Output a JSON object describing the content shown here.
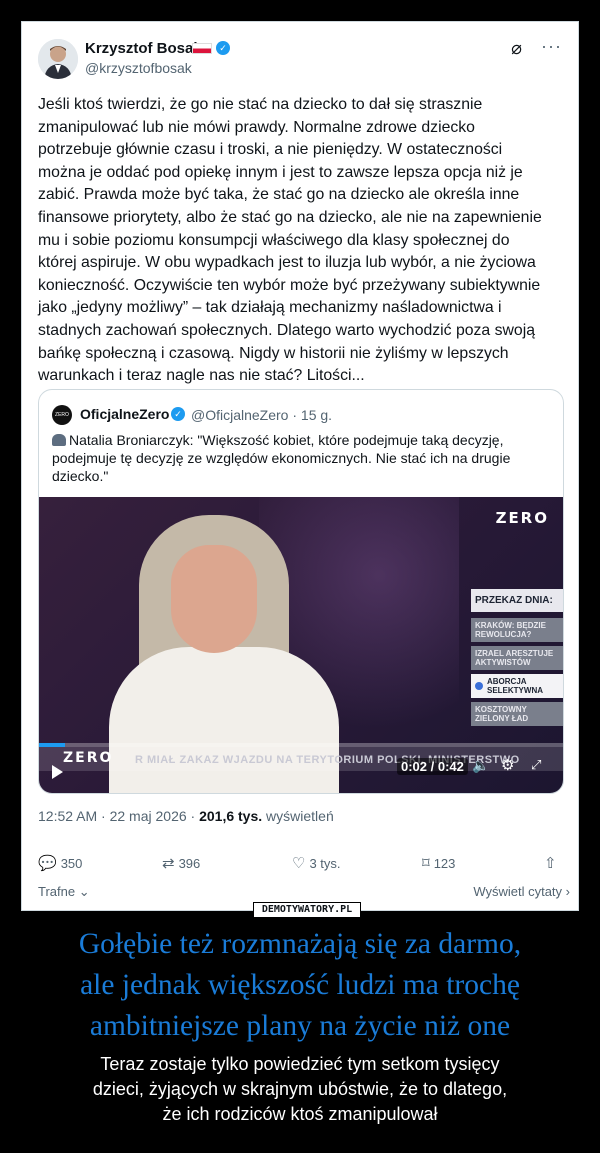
{
  "tweet": {
    "author_name": "Krzysztof Bosak",
    "author_handle": "@krzysztofbosak",
    "body": "Jeśli ktoś twierdzi, że go nie stać na dziecko to dał się strasznie\nzmanipulować lub nie mówi prawdy. Normalne zdrowe dziecko\npotrzebuje głównie czasu i troski, a nie pieniędzy. W ostateczności\nmożna je oddać pod opiekę innym i jest to zawsze lepsza opcja niż je\nzabić. Prawda może być taka, że stać go na dziecko ale określa inne\nfinansowe priorytety, albo że stać go na dziecko, ale nie na zapewnienie\nmu i sobie poziomu konsumpcji właściwego dla klasy społecznej do\nktórej aspiruje. W obu wypadkach jest to iluzja lub wybór, a nie życiowa\nkonieczność. Oczywiście ten wybór może być przeżywany subiektywnie\njako „jedyny możliwy” – tak działają mechanizmy naśladownictwa i\nstadnych zachowań społecznych. Dlatego warto wychodzić poza swoją\nbańkę społeczną i czasową. Nigdy w historii nie żyliśmy w lepszych\nwarunkach i teraz nagle nas nie stać? Litości...",
    "timestamp": "12:52 AM · 22 maj 2026 · ",
    "views_count": "201,6 tys.",
    "views_label": " wyświetleń",
    "replies": "350",
    "reposts": "396",
    "likes": "3 tys.",
    "bookmarks": "123",
    "sort_label": "Trafne",
    "quotes_label": "Wyświetl cytaty"
  },
  "quoted": {
    "author_name": "OficjalneZero",
    "author_handle": "@OficjalneZero · 15 g.",
    "body": "Natalia Broniarczyk: \"Większość kobiet, które podejmuje taką decyzję,\npodejmuje tę decyzję ze względów ekonomicznych.  Nie stać ich na drugie\ndziecko.\""
  },
  "video": {
    "logo": "ZERO",
    "panel_title": "PRZEKAZ DNIA:",
    "panel_items": [
      "KRAKÓW: BĘDZIE REWOLUCJA?",
      "IZRAEL ARESZTUJE AKTYWISTÓW",
      "ABORCJA SELEKTYWNA",
      "KOSZTOWNY ZIELONY ŁAD"
    ],
    "ticker_logo": "ZERO",
    "ticker_text": "R MIAŁ ZAKAZ WJAZDU NA TERYTORIUM POLSKI. MINISTERSTWO",
    "time": "0:02 / 0:42",
    "progress": 0.05
  },
  "watermark": "DEMOTYWATORY.PL",
  "caption": {
    "title": "Gołębie też rozmnażają się za darmo,\nale jednak większość ludzi ma trochę\nambitniejsze plany na życie niż one",
    "subtitle": "Teraz zostaje tylko powiedzieć tym setkom tysięcy\ndzieci, żyjących w skrajnym ubóstwie, że to dlatego,\nże ich rodziców ktoś zmanipulował"
  },
  "colors": {
    "accent": "#1d9bf0",
    "title": "#1a7cd8"
  },
  "icons": [
    "verified-icon",
    "grok-icon",
    "more-icon",
    "reply-icon",
    "repost-icon",
    "like-icon",
    "bookmark-icon",
    "share-icon",
    "play-icon",
    "volume-icon",
    "settings-icon",
    "fullscreen-icon"
  ]
}
